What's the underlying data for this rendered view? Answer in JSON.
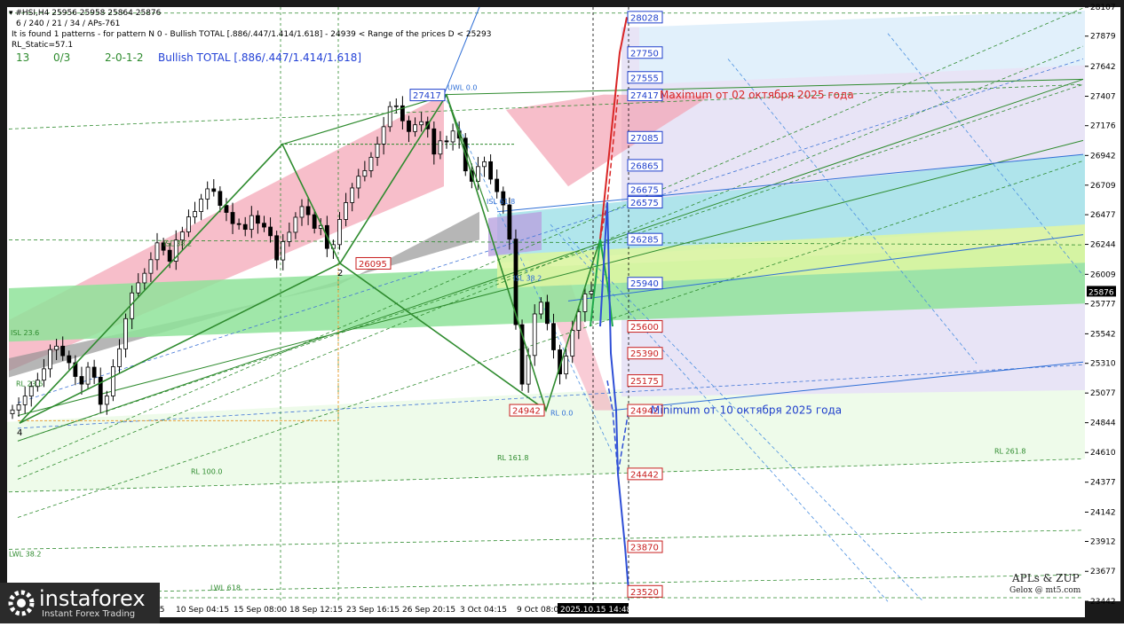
{
  "header": {
    "line1": "▾ #HSI,H4  25956 25958 25864 25876",
    "line2": "6 / 240 / 21 / 34 / APs-761",
    "line3": "It is found 1 patterns  -  for pattern N 0 - Bullish TOTAL [.886/.447/1.414/1.618] - 24939 < Range of the prices D < 25293",
    "line4": "RL_Static=57.1"
  },
  "stats": {
    "count": "13",
    "ratio": "0/3",
    "sequence": "2-0-1-2",
    "pattern": "Bullish TOTAL [.886/.447/1.414/1.618]"
  },
  "brand": {
    "name": "instaforex",
    "tagline": "Instant Forex Trading"
  },
  "watermark": {
    "line1": "APLs & ZUP",
    "line2": "Gelox @ mt5.com"
  },
  "colors": {
    "bg": "#ffffff",
    "frame": "#1a1a1a",
    "axis_text": "#000000",
    "pink": "#f4a3b4",
    "gray": "#8f8f8f",
    "green": "#8fe39a",
    "cyan": "#a9e3ea",
    "lime": "#dcf5a2",
    "lavender": "#e8e4f6",
    "pale_green": "#eefbea",
    "light_blue": "#e1f0fb",
    "pattern_green": "#2e8b2e",
    "forecast_red": "#d92626",
    "forecast_green": "#1fa84a",
    "forecast_blue": "#2f4fd6",
    "label_blue": "#1f3fcc",
    "label_red": "#c81e1e"
  },
  "chart_data": {
    "type": "candlestick",
    "symbol": "#HSI",
    "timeframe": "H4",
    "ylim": [
      23442,
      28107
    ],
    "y_ticks": [
      28107,
      27879,
      27642,
      27407,
      27176,
      26942,
      26709,
      26477,
      26244,
      26009,
      25777,
      25542,
      25310,
      25077,
      24844,
      24610,
      24377,
      24142,
      23912,
      23677,
      23442
    ],
    "current_price": "25876",
    "x_labels": [
      "10 Sep 04:15",
      "15 Sep 08:00",
      "18 Sep 12:15",
      "23 Sep 16:15",
      "26 Sep 20:15",
      "3 Oct 04:15",
      "9 Oct 08:00"
    ],
    "x_label_partial": "15",
    "current_time_label": "2025.10.15 14:48",
    "closes": [
      24944,
      24985,
      25053,
      25128,
      25178,
      25267,
      25418,
      25445,
      25370,
      25315,
      25207,
      25147,
      25280,
      25201,
      24988,
      25054,
      25284,
      25424,
      25661,
      25863,
      25942,
      26017,
      26124,
      26256,
      26198,
      26112,
      26278,
      26342,
      26460,
      26502,
      26600,
      26680,
      26660,
      26550,
      26495,
      26407,
      26400,
      26362,
      26470,
      26410,
      26380,
      26312,
      26122,
      26266,
      26339,
      26457,
      26541,
      26477,
      26370,
      26392,
      26212,
      26242,
      26440,
      26572,
      26687,
      26779,
      26823,
      26928,
      27032,
      27168,
      27326,
      27332,
      27214,
      27130,
      27183,
      27207,
      27151,
      26953,
      27057,
      27049,
      27134,
      27078,
      26821,
      26739,
      26855,
      26893,
      26756,
      26658,
      26554,
      26285,
      25614,
      25147,
      25372,
      25698,
      25790,
      25623,
      25416,
      25227,
      25367,
      25569,
      25716,
      25855,
      25876
    ],
    "pattern_points": [
      {
        "label": "4",
        "value": 24840
      },
      {
        "label": "",
        "value": 27030
      },
      {
        "label": "2",
        "value": 26095
      },
      {
        "label": "",
        "value": 27417
      },
      {
        "label": "",
        "value": 24942
      },
      {
        "label": "",
        "value": 26285
      }
    ],
    "price_labels_left": [
      {
        "text": "27417",
        "value": 27417,
        "color": "blue"
      },
      {
        "text": "26095",
        "value": 26095,
        "color": "red"
      },
      {
        "text": "24942",
        "value": 24942,
        "color": "red"
      }
    ],
    "price_labels_right": [
      {
        "text": "28028",
        "value": 28028,
        "color": "blue"
      },
      {
        "text": "27750",
        "value": 27750,
        "color": "blue"
      },
      {
        "text": "27555",
        "value": 27555,
        "color": "blue"
      },
      {
        "text": "27417",
        "value": 27417,
        "color": "blue"
      },
      {
        "text": "27085",
        "value": 27085,
        "color": "blue"
      },
      {
        "text": "26865",
        "value": 26865,
        "color": "blue"
      },
      {
        "text": "26675",
        "value": 26675,
        "color": "blue"
      },
      {
        "text": "26575",
        "value": 26575,
        "color": "blue"
      },
      {
        "text": "26285",
        "value": 26285,
        "color": "blue"
      },
      {
        "text": "25940",
        "value": 25940,
        "color": "blue"
      },
      {
        "text": "25600",
        "value": 25600,
        "color": "red"
      },
      {
        "text": "25390",
        "value": 25390,
        "color": "red"
      },
      {
        "text": "25175",
        "value": 25175,
        "color": "red"
      },
      {
        "text": "24942",
        "value": 24942,
        "color": "red"
      },
      {
        "text": "24442",
        "value": 24442,
        "color": "red"
      },
      {
        "text": "23870",
        "value": 23870,
        "color": "red"
      },
      {
        "text": "23520",
        "value": 23520,
        "color": "red"
      }
    ],
    "annotations": [
      {
        "text": "Maximum от 02 октября 2025 года",
        "value": 27417,
        "color": "red"
      },
      {
        "text": "Minimum от 10 октября 2025 года",
        "value": 24942,
        "color": "blue"
      }
    ],
    "level_labels": [
      "ISL 38.2",
      "ISL 23.6",
      "RL 23.6",
      "RL 100.0",
      "RL 161.8",
      "RL 261.8",
      "LWL 38.2",
      "LWL 618",
      "UWL 0.0",
      "ISL 61.8",
      "ISL 38.2",
      "RL 0.0"
    ]
  }
}
